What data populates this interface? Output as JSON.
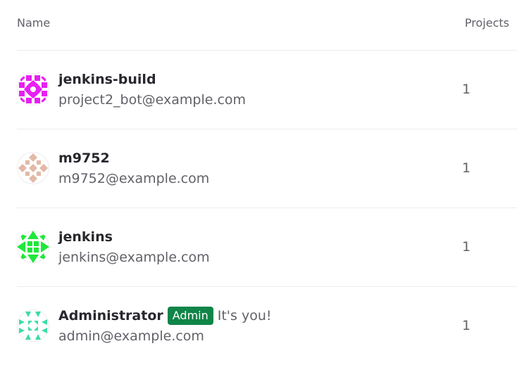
{
  "table": {
    "headers": {
      "name": "Name",
      "projects": "Projects"
    },
    "users": [
      {
        "name": "jenkins-build",
        "email": "project2_bot@example.com",
        "projects": "1",
        "avatar_color": "#e81ff2",
        "avatar_icon": "identicon-avatar"
      },
      {
        "name": "m9752",
        "email": "m9752@example.com",
        "projects": "1",
        "avatar_color": "#e2b9a6",
        "avatar_icon": "identicon-avatar"
      },
      {
        "name": "jenkins",
        "email": "jenkins@example.com",
        "projects": "1",
        "avatar_color": "#1ee83a",
        "avatar_icon": "identicon-avatar"
      },
      {
        "name": "Administrator",
        "badge": "Admin",
        "note": "It's you!",
        "email": "admin@example.com",
        "projects": "1",
        "avatar_color": "#3ddca5",
        "avatar_icon": "identicon-avatar",
        "badge_color": "#108548"
      }
    ]
  }
}
